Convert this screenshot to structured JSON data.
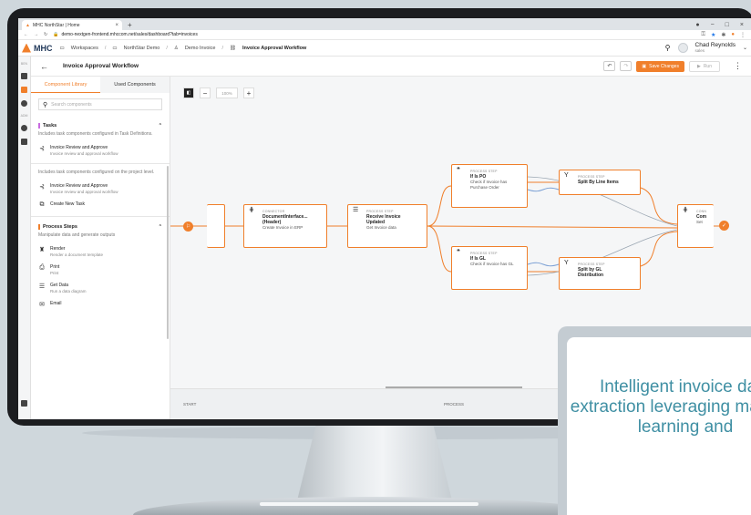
{
  "browser": {
    "tab_title": "MHC NorthStar | Home",
    "url": "demo-nextgen-frontend.mhccom.net/sales/dashboard?tab=invoices"
  },
  "app": {
    "logo_text": "MHC",
    "breadcrumbs": [
      "Workspaces",
      "NorthStar Demo",
      "Demo Invoice",
      "Invoice Approval Workflow"
    ],
    "user_name": "Chad Reynolds",
    "user_role": "sales",
    "rail_labels": [
      "BEN",
      "ADM"
    ]
  },
  "workflow": {
    "title": "Invoice Approval Workflow",
    "save_label": "Save Changes",
    "run_label": "Run",
    "zoom": "100%"
  },
  "library": {
    "tabs": [
      "Component Library",
      "Used Components"
    ],
    "search_placeholder": "Search components",
    "tasks_title": "Tasks",
    "tasks_desc": "Includes task components configured in Task Definitions.",
    "task1_title": "Invoice Review and Approve",
    "task1_sub": "Invoice review and approval workflow",
    "project_desc": "Includes task components configured on the project level.",
    "task2_title": "Invoice Review and Approve",
    "task2_sub": "Invoice review and approval workflow",
    "create_task": "Create New Task",
    "steps_title": "Process Steps",
    "steps_desc": "Manipulate data and generate outputs",
    "steps": [
      {
        "title": "Render",
        "sub": "Render a document template"
      },
      {
        "title": "Print",
        "sub": "Print"
      },
      {
        "title": "Get Data",
        "sub": "Run a data diagram"
      },
      {
        "title": "Email",
        "sub": ""
      }
    ]
  },
  "canvas": {
    "lanes": [
      "START",
      "PROCESS"
    ],
    "nodes": {
      "connector": {
        "kind": "CONNECTOR",
        "name": "DocumentInterface...",
        "line2": "(Header)",
        "desc": "Create Invoice in ERP"
      },
      "receive": {
        "kind": "PROCESS STEP",
        "name": "Receive Invoice",
        "line2": "Updated",
        "desc": "Get Invoice data"
      },
      "ispo": {
        "kind": "PROCESS STEP",
        "name": "If Is PO",
        "desc": "Check if Invoice has Purchase Order"
      },
      "isgl": {
        "kind": "PROCESS STEP",
        "name": "If Is GL",
        "desc": "Check if Invoice has GL"
      },
      "split1": {
        "kind": "PROCESS STEP",
        "name": "Split By Line Items"
      },
      "split2": {
        "kind": "PROCESS STEP",
        "name": "Split by GL",
        "line2": "Distribution"
      },
      "end": {
        "kind": "CONN",
        "name": "Com",
        "desc": "Set"
      }
    }
  },
  "caption": "Intelligent invoice data extraction leveraging machine learning and",
  "colors": {
    "accent": "#f07f2b",
    "caption": "#3f8fa3"
  }
}
